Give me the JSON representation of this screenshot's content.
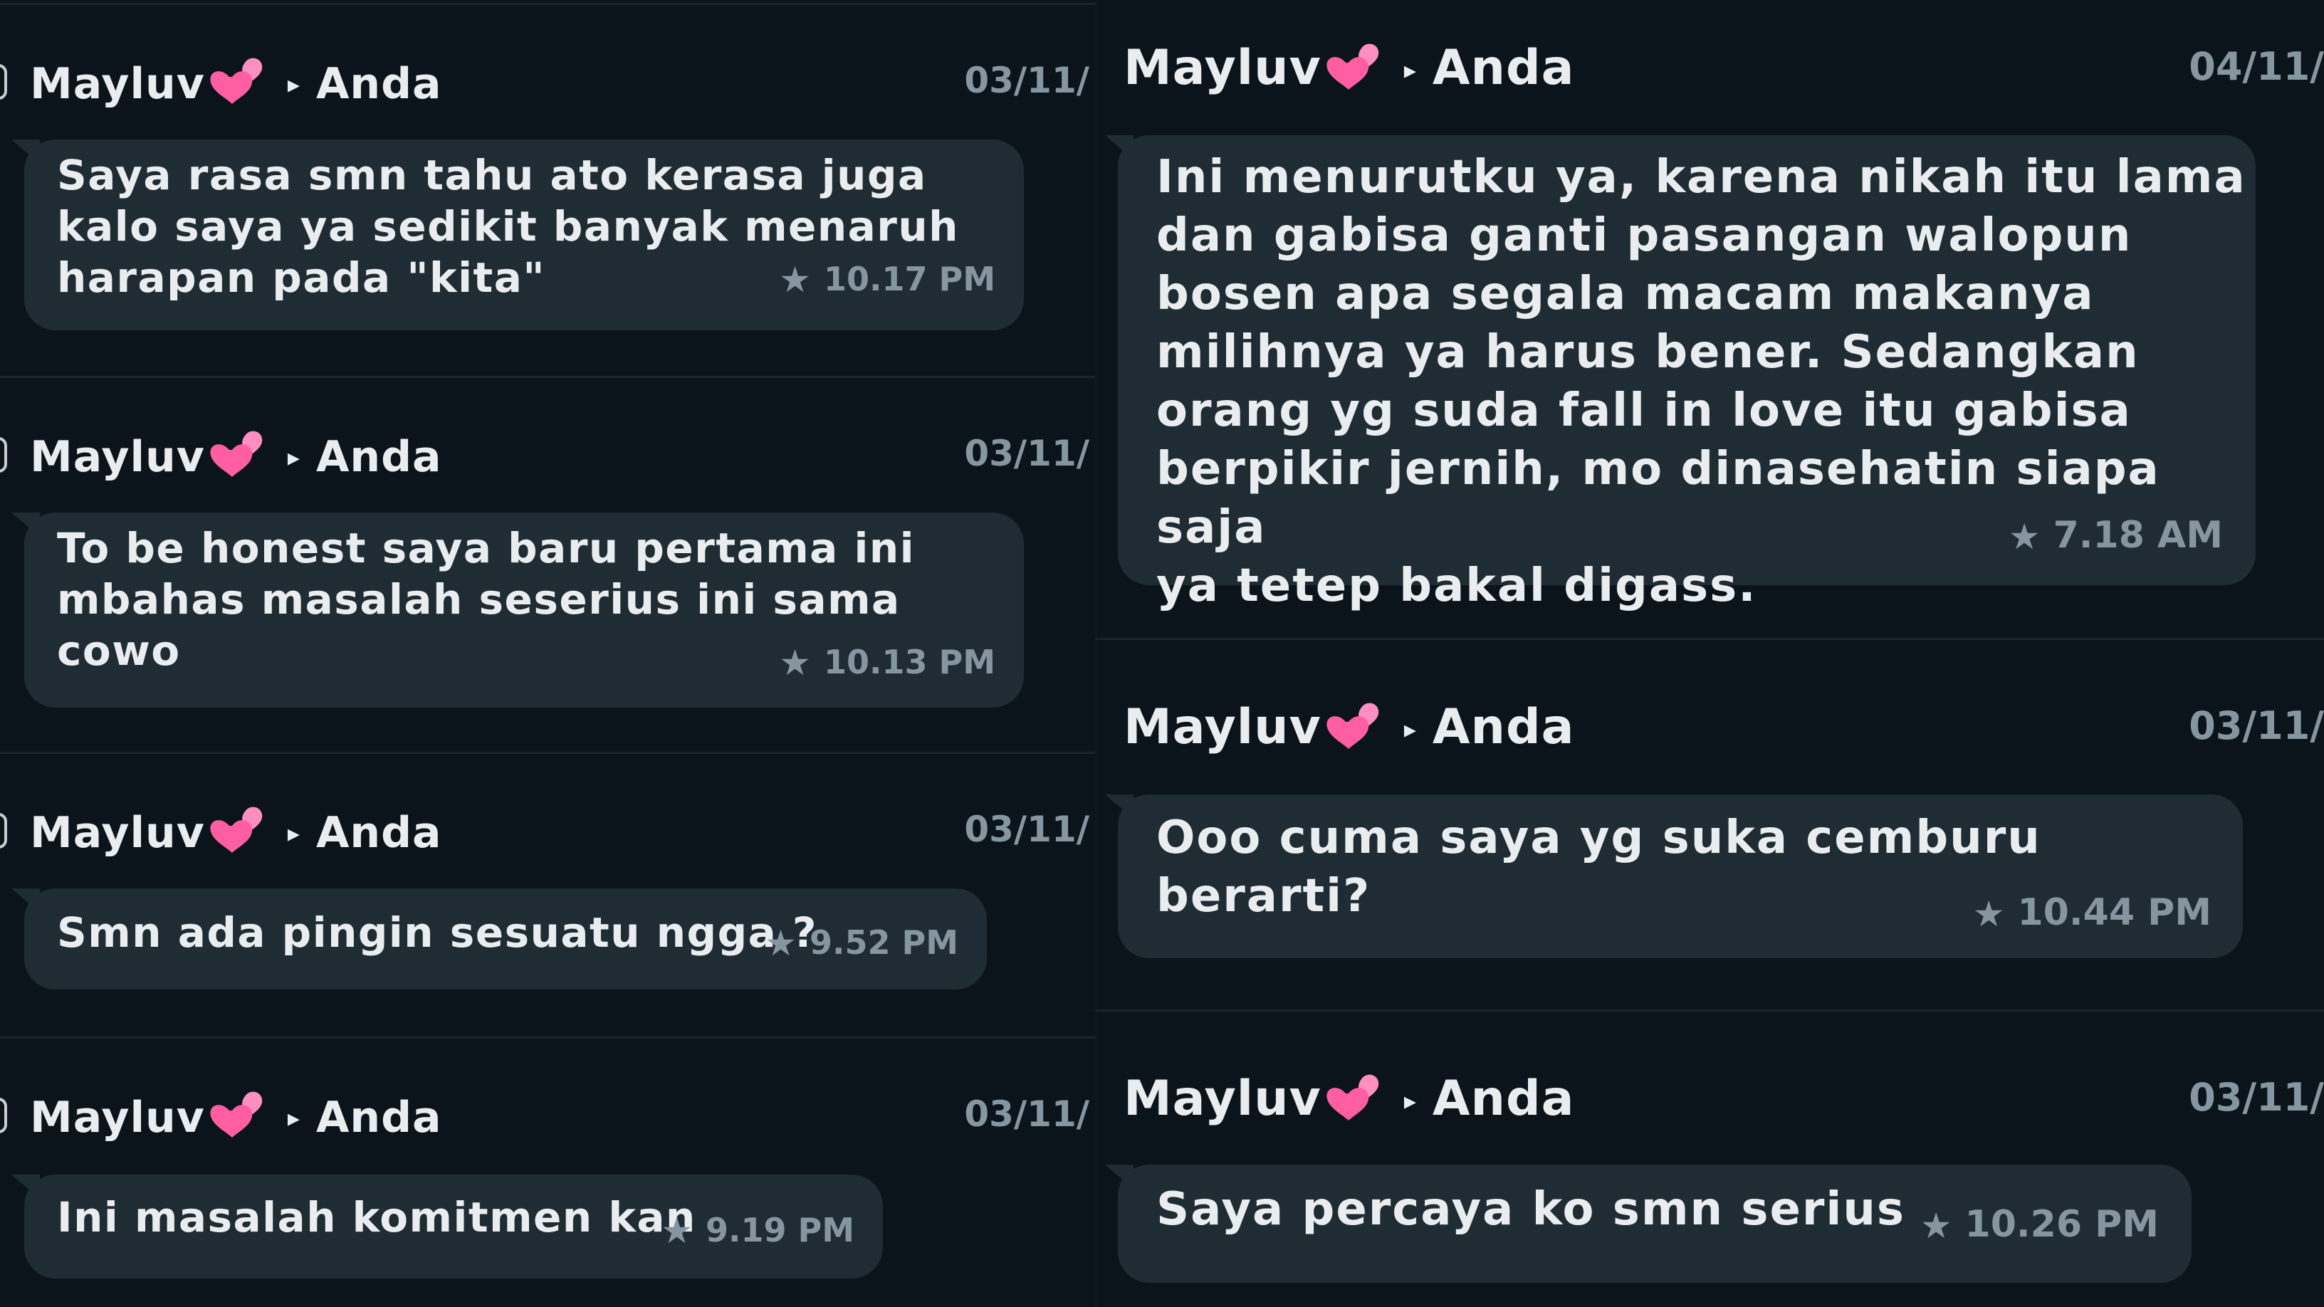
{
  "colors": {
    "background": "#0b141a",
    "bubble": "#202c33",
    "text": "#e9edef",
    "meta": "#8696a0",
    "heart": "#ff5fa2"
  },
  "icons": {
    "heart": "two-hearts-emoji",
    "arrow": "right-triangle",
    "star": "star-icon"
  },
  "left_column": [
    {
      "sender": "Mayluv",
      "arrow": "▸",
      "recipient": "Anda",
      "date": "03/11/",
      "text": "Saya rasa smn tahu ato kerasa juga\nkalo saya ya sedikit banyak menaruh\nharapan pada \"kita\"",
      "star": "★",
      "time": "10.17 PM"
    },
    {
      "sender": "Mayluv",
      "arrow": "▸",
      "recipient": "Anda",
      "date": "03/11/",
      "text": "To be honest saya baru pertama ini\nmbahas masalah seserius ini sama cowo",
      "star": "★",
      "time": "10.13 PM"
    },
    {
      "sender": "Mayluv",
      "arrow": "▸",
      "recipient": "Anda",
      "date": "03/11/",
      "text": "Smn ada pingin sesuatu ngga ?",
      "star": "★",
      "time": "9.52 PM"
    },
    {
      "sender": "Mayluv",
      "arrow": "▸",
      "recipient": "Anda",
      "date": "03/11/",
      "text": "Ini masalah komitmen kan",
      "star": "★",
      "time": "9.19 PM"
    }
  ],
  "right_column": [
    {
      "sender": "Mayluv",
      "arrow": "▸",
      "recipient": "Anda",
      "date": "04/11/",
      "text": "Ini menurutku ya, karena nikah itu lama\ndan gabisa ganti pasangan walopun\nbosen apa segala macam makanya\nmilihnya ya harus bener. Sedangkan\norang yg suda fall in love itu gabisa\nberpikir jernih, mo dinasehatin siapa saja\nya tetep bakal digass.",
      "star": "★",
      "time": "7.18 AM"
    },
    {
      "sender": "Mayluv",
      "arrow": "▸",
      "recipient": "Anda",
      "date": "03/11/",
      "text": "Ooo cuma saya yg suka cemburu berarti?",
      "star": "★",
      "time": "10.44 PM"
    },
    {
      "sender": "Mayluv",
      "arrow": "▸",
      "recipient": "Anda",
      "date": "03/11/",
      "text": "Saya percaya ko smn serius",
      "star": "★",
      "time": "10.26 PM"
    }
  ]
}
